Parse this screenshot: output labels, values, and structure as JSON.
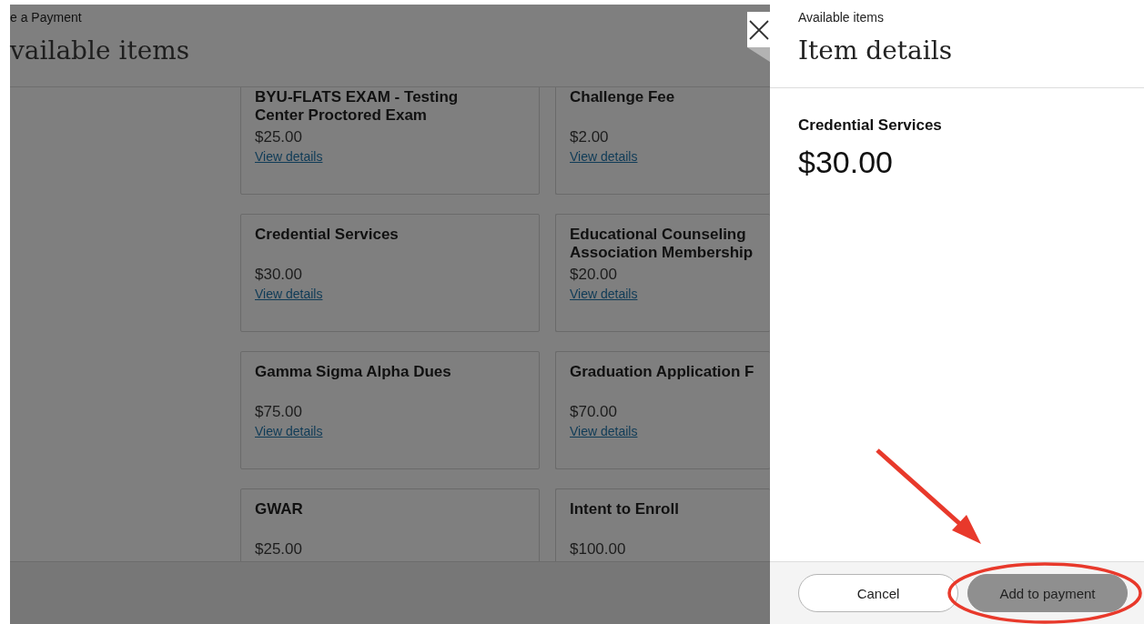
{
  "page": {
    "breadcrumb": "e a Payment",
    "title": "vailable items"
  },
  "items": [
    {
      "name": "BYU-FLATS EXAM - Testing Center Proctored Exam",
      "price": "$25.00",
      "link": "View details"
    },
    {
      "name": "Challenge Fee",
      "price": "$2.00",
      "link": "View details"
    },
    {
      "name": "Credential Services",
      "price": "$30.00",
      "link": "View details"
    },
    {
      "name": "Educational Counseling Association Membership",
      "price": "$20.00",
      "link": "View details"
    },
    {
      "name": "Gamma Sigma Alpha Dues",
      "price": "$75.00",
      "link": "View details"
    },
    {
      "name": "Graduation Application F",
      "price": "$70.00",
      "link": "View details"
    },
    {
      "name": "GWAR",
      "price": "$25.00"
    },
    {
      "name": "Intent to Enroll",
      "price": "$100.00"
    }
  ],
  "panel": {
    "breadcrumb": "Available items",
    "title": "Item details",
    "item_name": "Credential Services",
    "price": "$30.00",
    "buttons": [
      {
        "label": "Cancel",
        "kind": "secondary"
      },
      {
        "label": "Add to payment",
        "kind": "primary"
      }
    ]
  }
}
